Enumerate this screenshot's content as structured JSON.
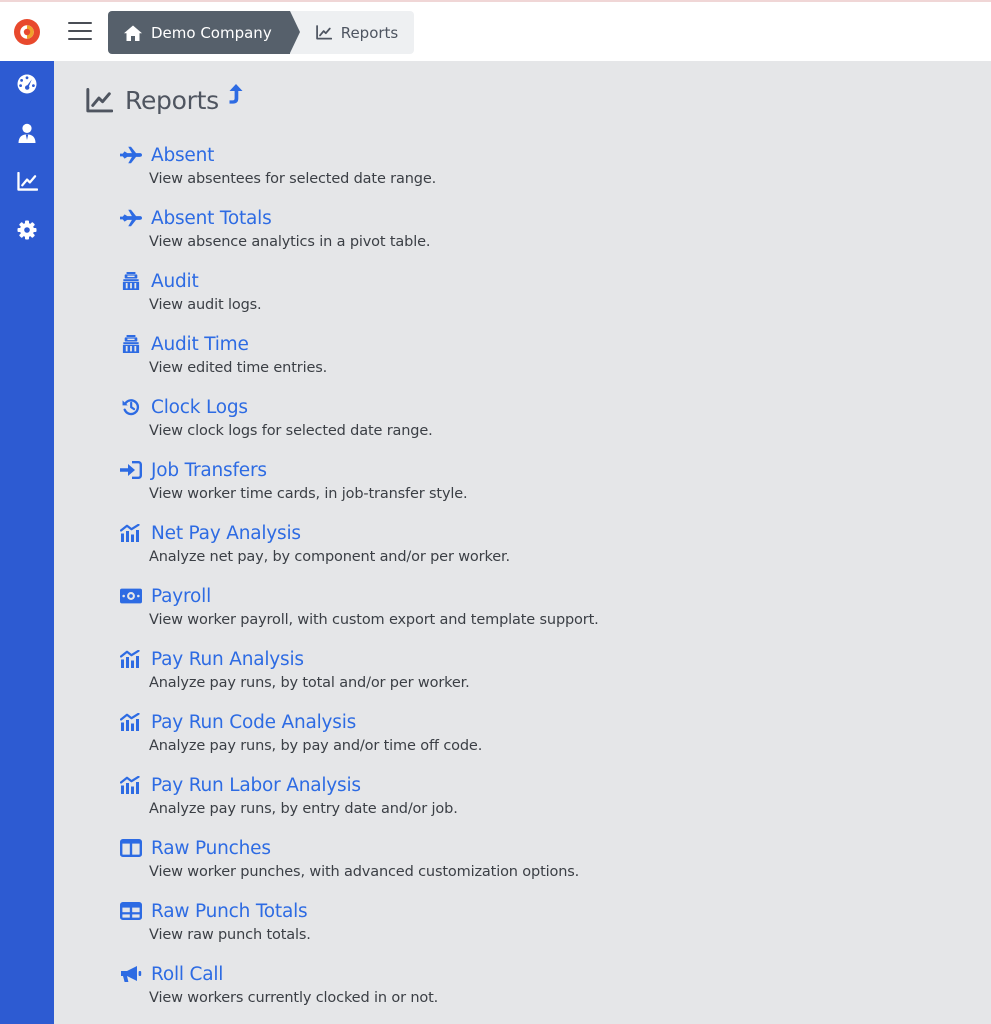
{
  "colors": {
    "sidebar": "#2d5bd2",
    "link": "#2d6be3",
    "breadcrumb_home": "#56606b",
    "background": "#e5e6e8"
  },
  "breadcrumb": {
    "home_label": "Demo Company",
    "home_icon": "home-icon",
    "current_label": "Reports",
    "current_icon": "line-chart-icon"
  },
  "sidebar": {
    "items": [
      {
        "icon": "dashboard-icon"
      },
      {
        "icon": "worker-icon"
      },
      {
        "icon": "line-chart-icon"
      },
      {
        "icon": "gear-icon"
      }
    ]
  },
  "page": {
    "title": "Reports",
    "title_icon": "line-chart-icon",
    "up_icon": "level-up-icon"
  },
  "reports": [
    {
      "title": "Absent",
      "description": "View absentees for selected date range.",
      "icon": "plane-icon"
    },
    {
      "title": "Absent Totals",
      "description": "View absence analytics in a pivot table.",
      "icon": "plane-icon"
    },
    {
      "title": "Audit",
      "description": "View audit logs.",
      "icon": "auditor-icon"
    },
    {
      "title": "Audit Time",
      "description": "View edited time entries.",
      "icon": "auditor-icon"
    },
    {
      "title": "Clock Logs",
      "description": "View clock logs for selected date range.",
      "icon": "history-icon"
    },
    {
      "title": "Job Transfers",
      "description": "View worker time cards, in job-transfer style.",
      "icon": "sign-in-icon"
    },
    {
      "title": "Net Pay Analysis",
      "description": "Analyze net pay, by component and/or per worker.",
      "icon": "analytics-icon"
    },
    {
      "title": "Payroll",
      "description": "View worker payroll, with custom export and template support.",
      "icon": "money-bill-icon"
    },
    {
      "title": "Pay Run Analysis",
      "description": "Analyze pay runs, by total and/or per worker.",
      "icon": "analytics-icon"
    },
    {
      "title": "Pay Run Code Analysis",
      "description": "Analyze pay runs, by pay and/or time off code.",
      "icon": "analytics-icon"
    },
    {
      "title": "Pay Run Labor Analysis",
      "description": "Analyze pay runs, by entry date and/or job.",
      "icon": "analytics-icon"
    },
    {
      "title": "Raw Punches",
      "description": "View worker punches, with advanced customization options.",
      "icon": "columns-icon"
    },
    {
      "title": "Raw Punch Totals",
      "description": "View raw punch totals.",
      "icon": "table-icon"
    },
    {
      "title": "Roll Call",
      "description": "View workers currently clocked in or not.",
      "icon": "bullhorn-icon"
    }
  ]
}
